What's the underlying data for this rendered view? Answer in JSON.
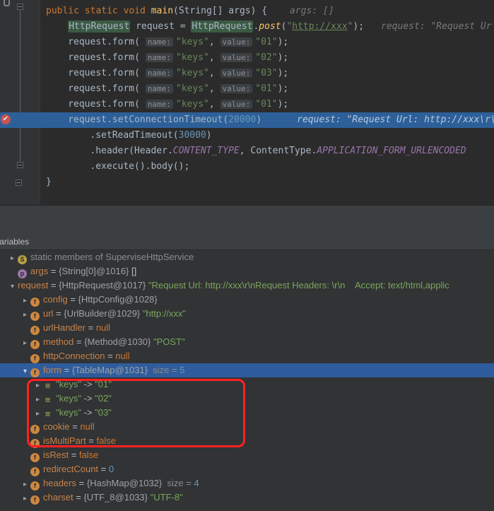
{
  "colors": {
    "editor_bg": "#2B2B2B",
    "gutter_bg": "#313335",
    "panel_bg": "#3C3F41",
    "tree_bg": "#313335",
    "exec_line": "#2D6099",
    "selection": "#2F5C9C",
    "usage_highlight": "#3B5A43",
    "annotation_red": "#FF2222",
    "breakpoint_red": "#C75450"
  },
  "icons": {
    "chevron_right": "▸",
    "chevron_down": "▾",
    "breakpoint_check": "✔"
  },
  "editor": {
    "lines": [
      {
        "indent": 0,
        "tokens": [
          {
            "t": "public static void ",
            "c": "kw"
          },
          {
            "t": "main",
            "c": "mn"
          },
          {
            "t": "(String[] args) { ",
            "c": "pl"
          },
          {
            "t": "args: []",
            "c": "hint"
          }
        ]
      },
      {
        "indent": 1,
        "tokens": [
          {
            "t": "HttpRequest",
            "c": "hl"
          },
          {
            "t": " request = ",
            "c": "pl"
          },
          {
            "t": "HttpRequest",
            "c": "hl"
          },
          {
            "t": ".",
            "c": "pl"
          },
          {
            "t": "post",
            "c": "smethod"
          },
          {
            "t": "(",
            "c": "pl"
          },
          {
            "t": "\"",
            "c": "str"
          },
          {
            "t": "http://xxx",
            "c": "strU"
          },
          {
            "t": "\"",
            "c": "str"
          },
          {
            "t": ");",
            "c": "pl"
          },
          {
            "t": "request: \"Request Ur",
            "c": "hint"
          }
        ]
      },
      {
        "indent": 1,
        "tokens": [
          {
            "t": "request.form( ",
            "c": "pl"
          },
          {
            "t": "name:",
            "c": "pill"
          },
          {
            "t": "\"keys\"",
            "c": "str"
          },
          {
            "t": ", ",
            "c": "pl"
          },
          {
            "t": "value:",
            "c": "pill"
          },
          {
            "t": "\"01\"",
            "c": "str"
          },
          {
            "t": ");",
            "c": "pl"
          }
        ]
      },
      {
        "indent": 1,
        "tokens": [
          {
            "t": "request.form( ",
            "c": "pl"
          },
          {
            "t": "name:",
            "c": "pill"
          },
          {
            "t": "\"keys\"",
            "c": "str"
          },
          {
            "t": ", ",
            "c": "pl"
          },
          {
            "t": "value:",
            "c": "pill"
          },
          {
            "t": "\"02\"",
            "c": "str"
          },
          {
            "t": ");",
            "c": "pl"
          }
        ]
      },
      {
        "indent": 1,
        "tokens": [
          {
            "t": "request.form( ",
            "c": "pl"
          },
          {
            "t": "name:",
            "c": "pill"
          },
          {
            "t": "\"keys\"",
            "c": "str"
          },
          {
            "t": ", ",
            "c": "pl"
          },
          {
            "t": "value:",
            "c": "pill"
          },
          {
            "t": "\"03\"",
            "c": "str"
          },
          {
            "t": ");",
            "c": "pl"
          }
        ]
      },
      {
        "indent": 1,
        "tokens": [
          {
            "t": "request.form( ",
            "c": "pl"
          },
          {
            "t": "name:",
            "c": "pill"
          },
          {
            "t": "\"keys\"",
            "c": "str"
          },
          {
            "t": ", ",
            "c": "pl"
          },
          {
            "t": "value:",
            "c": "pill"
          },
          {
            "t": "\"01\"",
            "c": "str"
          },
          {
            "t": ");",
            "c": "pl"
          }
        ]
      },
      {
        "indent": 1,
        "tokens": [
          {
            "t": "request.form( ",
            "c": "pl"
          },
          {
            "t": "name:",
            "c": "pill"
          },
          {
            "t": "\"keys\"",
            "c": "str"
          },
          {
            "t": ", ",
            "c": "pl"
          },
          {
            "t": "value:",
            "c": "pill"
          },
          {
            "t": "\"01\"",
            "c": "str"
          },
          {
            "t": ");",
            "c": "pl"
          }
        ]
      },
      {
        "indent": 1,
        "exec": true,
        "tokens": [
          {
            "t": "request.setConnectionTimeout(",
            "c": "pl"
          },
          {
            "t": "20000",
            "c": "num"
          },
          {
            "t": ")",
            "c": "pl"
          },
          {
            "t": "request: \"Request Url: http://xxx\\r\\nR",
            "c": "hintExec"
          }
        ]
      },
      {
        "indent": 2,
        "tokens": [
          {
            "t": ".setReadTimeout(",
            "c": "pl"
          },
          {
            "t": "30000",
            "c": "num"
          },
          {
            "t": ")",
            "c": "pl"
          }
        ]
      },
      {
        "indent": 2,
        "tokens": [
          {
            "t": ".header(Header.",
            "c": "pl"
          },
          {
            "t": "CONTENT_TYPE",
            "c": "field"
          },
          {
            "t": ", ContentType.",
            "c": "pl"
          },
          {
            "t": "APPLICATION_FORM_URLENCODED",
            "c": "field"
          }
        ]
      },
      {
        "indent": 2,
        "tokens": [
          {
            "t": ".execute().body();",
            "c": "pl"
          }
        ]
      },
      {
        "indent": 0,
        "tokens": [
          {
            "t": "}",
            "c": "pl"
          }
        ]
      }
    ]
  },
  "debugger": {
    "panel_label": "Variables",
    "icon_letters": {
      "s": "S",
      "p": "p",
      "f": "f",
      "entry": "≡"
    },
    "icon_names": {
      "s": "static-members-icon",
      "p": "parameter-icon",
      "f": "field-icon",
      "entry": "map-entry-icon"
    },
    "rows": [
      {
        "indent": 0,
        "chevron": "right",
        "icon": "s",
        "parts": [
          {
            "t": "static members of SuperviseHttpService",
            "c": "dim"
          }
        ]
      },
      {
        "indent": 0,
        "chevron": "none",
        "icon": "p",
        "parts": [
          {
            "t": "args",
            "c": "name"
          },
          {
            "t": " = ",
            "c": "eq"
          },
          {
            "t": "{String[0]@1016} ",
            "c": "ref"
          },
          {
            "t": "[]",
            "c": "pl"
          }
        ]
      },
      {
        "indent": 0,
        "chevron": "down",
        "icon": null,
        "parts": [
          {
            "t": "request",
            "c": "name"
          },
          {
            "t": " = ",
            "c": "eq"
          },
          {
            "t": "{HttpRequest@1017} ",
            "c": "ref"
          },
          {
            "t": "\"Request Url: http://xxx\\r\\nRequest Headers: \\r\\n    Accept: text/html,applic",
            "c": "str"
          }
        ]
      },
      {
        "indent": 1,
        "chevron": "right",
        "icon": "f",
        "parts": [
          {
            "t": "config",
            "c": "name"
          },
          {
            "t": " = ",
            "c": "eq"
          },
          {
            "t": "{HttpConfig@1028}",
            "c": "ref"
          }
        ]
      },
      {
        "indent": 1,
        "chevron": "right",
        "icon": "f",
        "parts": [
          {
            "t": "url",
            "c": "name"
          },
          {
            "t": " = ",
            "c": "eq"
          },
          {
            "t": "{UrlBuilder@1029} ",
            "c": "ref"
          },
          {
            "t": "\"http://xxx\"",
            "c": "str"
          }
        ]
      },
      {
        "indent": 1,
        "chevron": "none",
        "icon": "f",
        "parts": [
          {
            "t": "urlHandler",
            "c": "name"
          },
          {
            "t": " = ",
            "c": "eq"
          },
          {
            "t": "null",
            "c": "kw"
          }
        ]
      },
      {
        "indent": 1,
        "chevron": "right",
        "icon": "f",
        "parts": [
          {
            "t": "method",
            "c": "name"
          },
          {
            "t": " = ",
            "c": "eq"
          },
          {
            "t": "{Method@1030} ",
            "c": "ref"
          },
          {
            "t": "\"POST\"",
            "c": "str"
          }
        ]
      },
      {
        "indent": 1,
        "chevron": "none",
        "icon": "f",
        "parts": [
          {
            "t": "httpConnection",
            "c": "name"
          },
          {
            "t": " = ",
            "c": "eq"
          },
          {
            "t": "null",
            "c": "kw"
          }
        ]
      },
      {
        "indent": 1,
        "chevron": "down",
        "icon": "f",
        "selected": true,
        "parts": [
          {
            "t": "form",
            "c": "name"
          },
          {
            "t": " = ",
            "c": "eq"
          },
          {
            "t": "{TableMap@1031}  ",
            "c": "ref"
          },
          {
            "t": "size = ",
            "c": "dim"
          },
          {
            "t": "5",
            "c": "num"
          }
        ]
      },
      {
        "indent": 2,
        "chevron": "right",
        "icon": "entry",
        "parts": [
          {
            "t": "\"keys\"",
            "c": "str"
          },
          {
            "t": " -> ",
            "c": "eq"
          },
          {
            "t": "\"01\"",
            "c": "str"
          }
        ]
      },
      {
        "indent": 2,
        "chevron": "right",
        "icon": "entry",
        "parts": [
          {
            "t": "\"keys\"",
            "c": "str"
          },
          {
            "t": " -> ",
            "c": "eq"
          },
          {
            "t": "\"02\"",
            "c": "str"
          }
        ]
      },
      {
        "indent": 2,
        "chevron": "right",
        "icon": "entry",
        "parts": [
          {
            "t": "\"keys\"",
            "c": "str"
          },
          {
            "t": " -> ",
            "c": "eq"
          },
          {
            "t": "\"03\"",
            "c": "str"
          }
        ]
      },
      {
        "indent": 1,
        "chevron": "none",
        "icon": "f",
        "parts": [
          {
            "t": "cookie",
            "c": "name"
          },
          {
            "t": " = ",
            "c": "eq"
          },
          {
            "t": "null",
            "c": "kw"
          }
        ]
      },
      {
        "indent": 1,
        "chevron": "none",
        "icon": "f",
        "parts": [
          {
            "t": "isMultiPart",
            "c": "name"
          },
          {
            "t": " = ",
            "c": "eq"
          },
          {
            "t": "false",
            "c": "kw"
          }
        ]
      },
      {
        "indent": 1,
        "chevron": "none",
        "icon": "f",
        "parts": [
          {
            "t": "isRest",
            "c": "name"
          },
          {
            "t": " = ",
            "c": "eq"
          },
          {
            "t": "false",
            "c": "kw"
          }
        ]
      },
      {
        "indent": 1,
        "chevron": "none",
        "icon": "f",
        "parts": [
          {
            "t": "redirectCount",
            "c": "name"
          },
          {
            "t": " = ",
            "c": "eq"
          },
          {
            "t": "0",
            "c": "num"
          }
        ]
      },
      {
        "indent": 1,
        "chevron": "right",
        "icon": "f",
        "parts": [
          {
            "t": "headers",
            "c": "name"
          },
          {
            "t": " = ",
            "c": "eq"
          },
          {
            "t": "{HashMap@1032}  ",
            "c": "ref"
          },
          {
            "t": "size = ",
            "c": "dim"
          },
          {
            "t": "4",
            "c": "num"
          }
        ]
      },
      {
        "indent": 1,
        "chevron": "right",
        "icon": "f",
        "parts": [
          {
            "t": "charset",
            "c": "name"
          },
          {
            "t": " = ",
            "c": "eq"
          },
          {
            "t": "{UTF_8@1033} ",
            "c": "ref"
          },
          {
            "t": "\"UTF-8\"",
            "c": "str"
          }
        ]
      }
    ]
  }
}
